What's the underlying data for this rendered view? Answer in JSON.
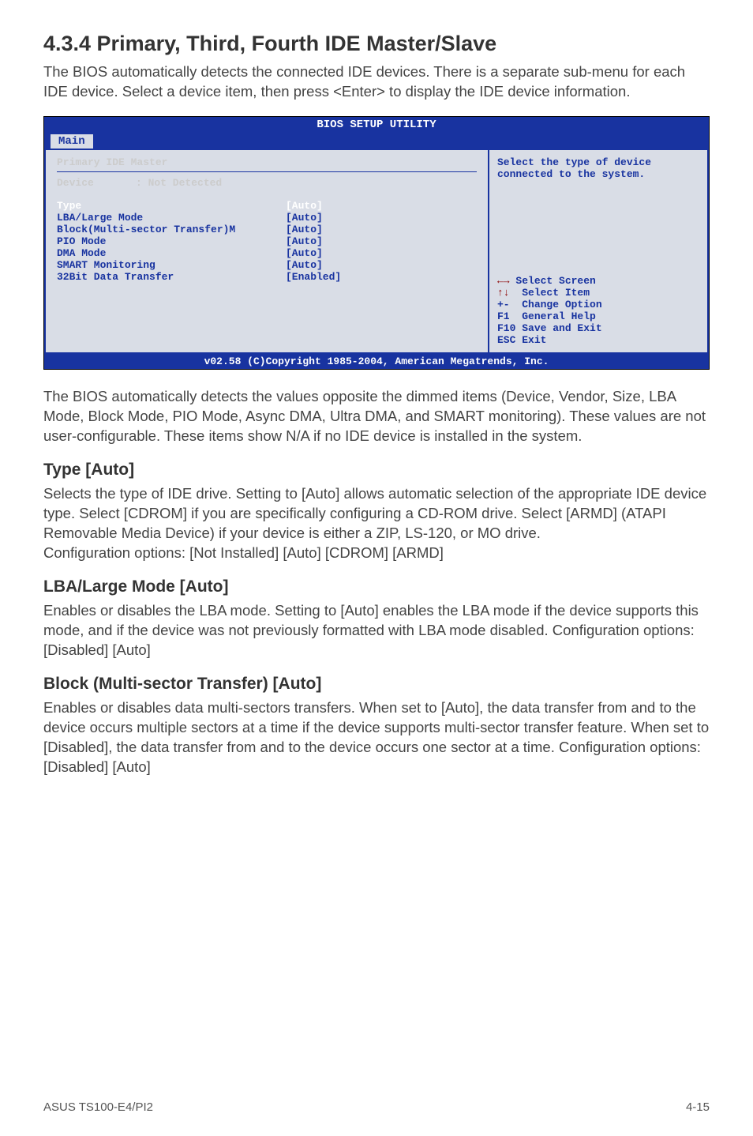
{
  "heading": "4.3.4  Primary, Third, Fourth IDE Master/Slave",
  "intro": "The BIOS automatically detects the connected IDE devices. There is a separate sub-menu for each IDE device. Select a device item, then press <Enter> to display the IDE device information.",
  "bios": {
    "title": "BIOS SETUP UTILITY",
    "tab": "Main",
    "panel_title": "Primary IDE Master",
    "device_label": "Device",
    "device_value": ": Not Detected",
    "rows": [
      {
        "k": "Type",
        "v": "[Auto]",
        "hl": true
      },
      {
        "k": "LBA/Large Mode",
        "v": "[Auto]"
      },
      {
        "k": "Block(Multi-sector Transfer)M",
        "v": "[Auto]"
      },
      {
        "k": "PIO Mode",
        "v": "[Auto]"
      },
      {
        "k": "DMA Mode",
        "v": "[Auto]"
      },
      {
        "k": "SMART Monitoring",
        "v": "[Auto]"
      },
      {
        "k": "32Bit Data Transfer",
        "v": "[Enabled]"
      }
    ],
    "help_top": "Select the type of device connected to the system.",
    "nav": {
      "select_screen": "Select Screen",
      "select_item": "Select Item",
      "change_option": "Change Option",
      "general_help": "General Help",
      "save_exit": "Save and Exit",
      "exit": "Exit",
      "plus_minus": "+-",
      "f1": "F1",
      "f10": "F10",
      "esc": "ESC"
    },
    "footer": "v02.58 (C)Copyright 1985-2004, American Megatrends, Inc."
  },
  "para2": "The BIOS automatically detects the values opposite the dimmed items (Device, Vendor, Size, LBA Mode, Block Mode, PIO Mode, Async DMA, Ultra DMA, and SMART monitoring). These values are not user-configurable. These items show N/A if no IDE device is installed in the system.",
  "sections": [
    {
      "title": "Type [Auto]",
      "body": "Selects the type of IDE drive. Setting to [Auto] allows automatic selection of the appropriate IDE device type. Select [CDROM] if you are specifically configuring a CD-ROM drive. Select [ARMD] (ATAPI Removable Media Device) if your device is either a ZIP, LS-120, or MO drive.\nConfiguration options: [Not Installed] [Auto] [CDROM] [ARMD]"
    },
    {
      "title": "LBA/Large Mode [Auto]",
      "body": "Enables or disables the LBA mode. Setting to [Auto] enables the LBA mode if the device supports this mode, and if the device was not previously formatted with LBA mode disabled. Configuration options: [Disabled] [Auto]"
    },
    {
      "title": "Block (Multi-sector Transfer) [Auto]",
      "body": "Enables or disables data multi-sectors transfers. When set to [Auto], the data transfer from and to the device occurs multiple sectors at a time if the device supports multi-sector transfer feature. When set to [Disabled], the data transfer from and to the device occurs one sector at a time. Configuration options: [Disabled] [Auto]"
    }
  ],
  "footer_left": "ASUS TS100-E4/PI2",
  "footer_right": "4-15"
}
